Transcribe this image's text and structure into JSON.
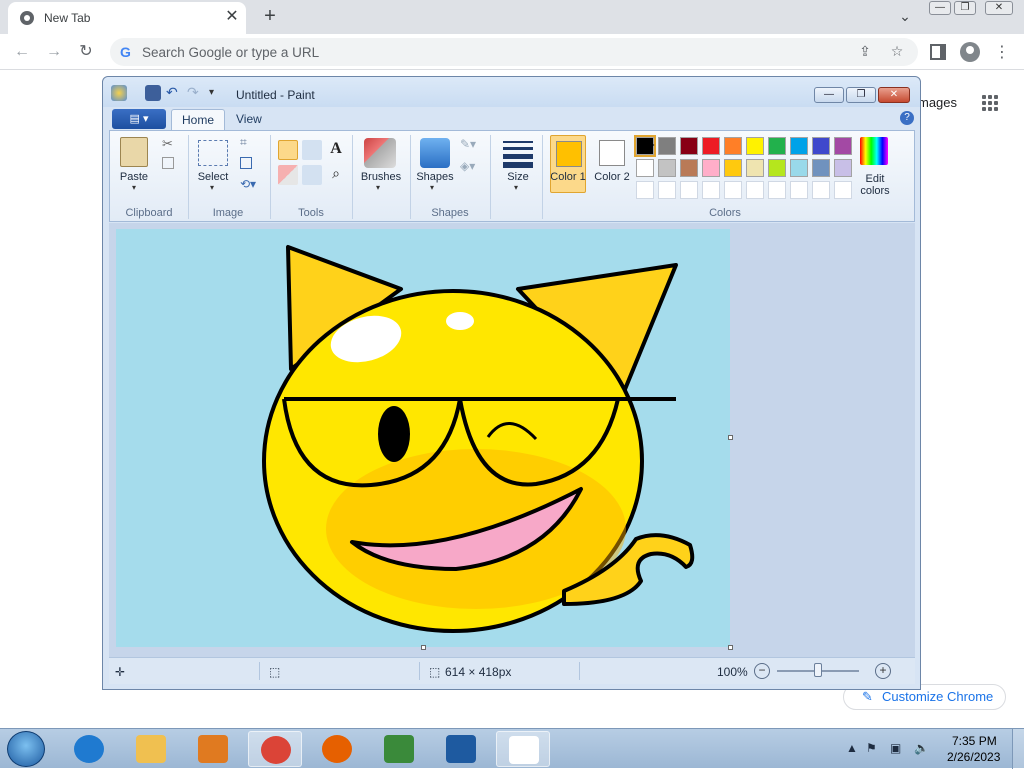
{
  "browser": {
    "tab_title": "New Tab",
    "tab_close": "✕",
    "new_tab": "+",
    "omnibox_placeholder": "Search Google or type a URL",
    "images_link": "mages",
    "customize_label": "Customize Chrome",
    "customize_icon": "✎",
    "window_controls": {
      "minimize": "—",
      "restore": "❐",
      "close": "✕"
    }
  },
  "paint": {
    "title": "Untitled - Paint",
    "tabs": [
      {
        "label": "Home",
        "active": true
      },
      {
        "label": "View",
        "active": false
      }
    ],
    "groups": {
      "clipboard": {
        "label": "Clipboard",
        "paste": "Paste"
      },
      "image": {
        "label": "Image",
        "select": "Select"
      },
      "tools": {
        "label": "Tools"
      },
      "shapes": {
        "label": "Shapes",
        "brushes": "Brushes",
        "shapes_btn": "Shapes",
        "size": "Size"
      },
      "colors": {
        "label": "Colors",
        "color1": "Color 1",
        "color2": "Color 2",
        "edit": "Edit colors"
      }
    },
    "color1_value": "#ffc000",
    "color2_value": "#ffffff",
    "palette": [
      [
        "#000000",
        "#7f7f7f",
        "#880015",
        "#ed1c24",
        "#ff7f27",
        "#fff200",
        "#22b14c",
        "#00a2e8",
        "#3f48cc",
        "#a349a4"
      ],
      [
        "#ffffff",
        "#c3c3c3",
        "#b97a57",
        "#ffaec9",
        "#ffc90e",
        "#efe4b0",
        "#b5e61d",
        "#99d9ea",
        "#7092be",
        "#c8bfe7"
      ],
      [
        "#ffffff",
        "#ffffff",
        "#ffffff",
        "#ffffff",
        "#ffffff",
        "#ffffff",
        "#ffffff",
        "#ffffff",
        "#ffffff",
        "#ffffff"
      ]
    ],
    "status": {
      "dimensions": "614 × 418px",
      "zoom": "100%",
      "zoom_minus": "−",
      "zoom_plus": "+"
    }
  },
  "taskbar": {
    "time": "7:35 PM",
    "date": "2/26/2023",
    "apps": [
      {
        "name": "internet-explorer",
        "color": "#1f7ad0"
      },
      {
        "name": "file-explorer",
        "color": "#f0c050"
      },
      {
        "name": "media-player",
        "color": "#e07a20"
      },
      {
        "name": "chrome",
        "color": "#db4437"
      },
      {
        "name": "firefox",
        "color": "#e66000"
      },
      {
        "name": "visual-csharp",
        "color": "#3a8a3a"
      },
      {
        "name": "visual-basic",
        "color": "#1e5aa0"
      },
      {
        "name": "paint",
        "color": "#ffffff"
      }
    ]
  }
}
